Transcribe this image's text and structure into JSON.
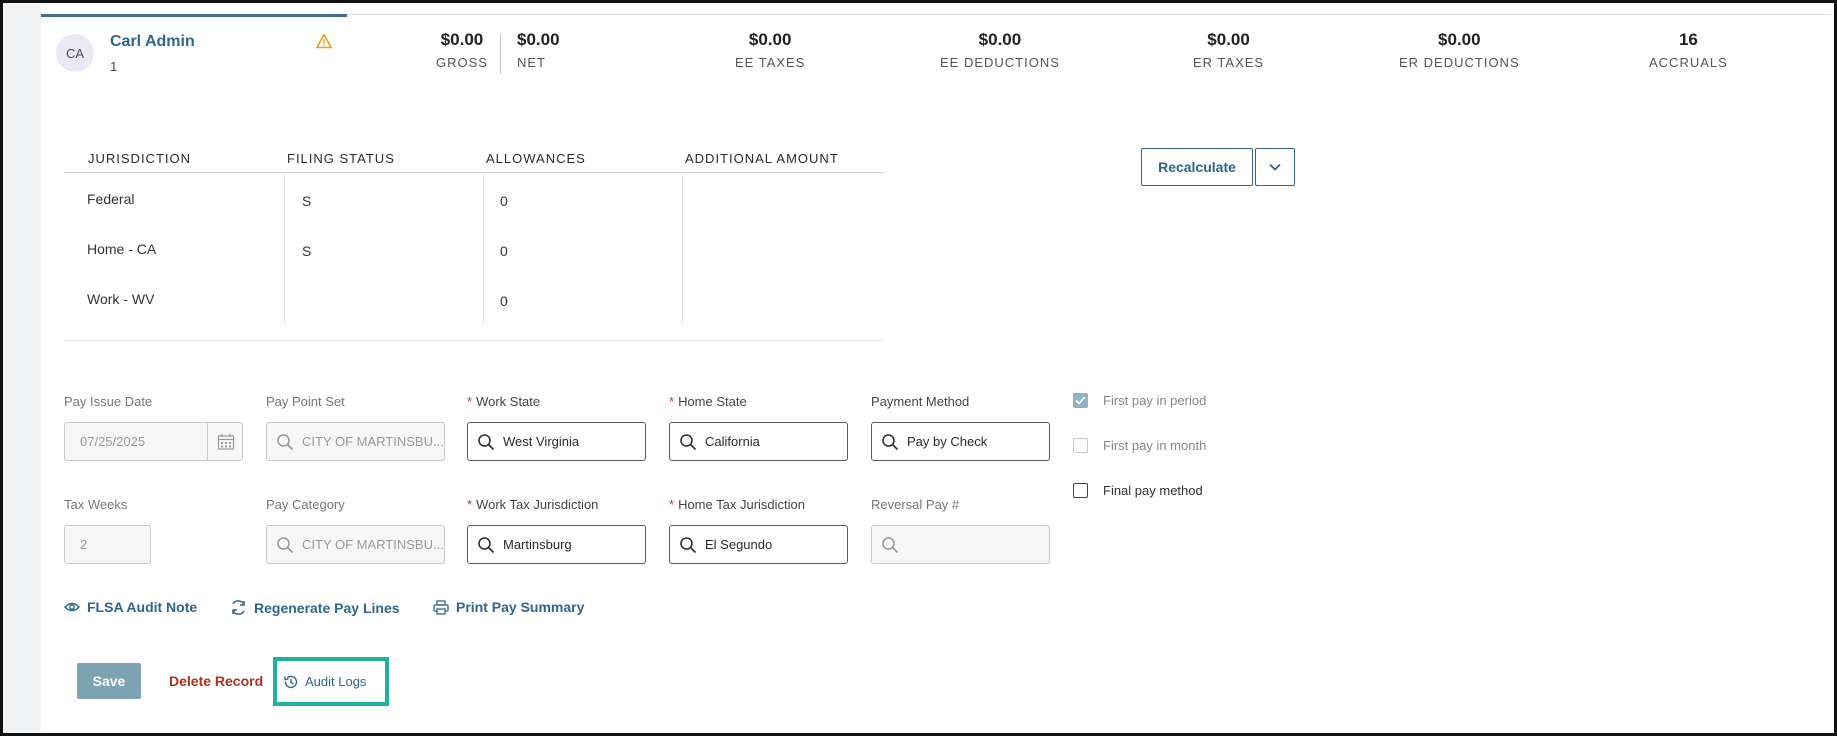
{
  "employee": {
    "initials": "CA",
    "name": "Carl Admin",
    "number": "1"
  },
  "metrics": [
    {
      "value": "$0.00",
      "label": "GROSS"
    },
    {
      "value": "$0.00",
      "label": "NET"
    },
    {
      "value": "$0.00",
      "label": "EE TAXES"
    },
    {
      "value": "$0.00",
      "label": "EE DEDUCTIONS"
    },
    {
      "value": "$0.00",
      "label": "ER TAXES"
    },
    {
      "value": "$0.00",
      "label": "ER DEDUCTIONS"
    },
    {
      "value": "16",
      "label": "ACCRUALS"
    }
  ],
  "tax_table": {
    "headers": [
      "JURISDICTION",
      "FILING STATUS",
      "ALLOWANCES",
      "ADDITIONAL AMOUNT"
    ],
    "rows": [
      {
        "jurisdiction": "Federal",
        "filing_status": "S",
        "allowances": "0",
        "additional": ""
      },
      {
        "jurisdiction": "Home - CA",
        "filing_status": "S",
        "allowances": "0",
        "additional": ""
      },
      {
        "jurisdiction": "Work - WV",
        "filing_status": "",
        "allowances": "0",
        "additional": ""
      }
    ]
  },
  "actions": {
    "recalculate": "Recalculate"
  },
  "form": {
    "pay_issue_date": {
      "label": "Pay Issue Date",
      "value": "07/25/2025"
    },
    "pay_point_set": {
      "label": "Pay Point Set",
      "value": "CITY OF MARTINSBU..."
    },
    "work_state": {
      "label": "Work State",
      "value": "West Virginia"
    },
    "home_state": {
      "label": "Home State",
      "value": "California"
    },
    "payment_method": {
      "label": "Payment Method",
      "value": "Pay by Check"
    },
    "tax_weeks": {
      "label": "Tax Weeks",
      "value": "2"
    },
    "pay_category": {
      "label": "Pay Category",
      "value": "CITY OF MARTINSBU..."
    },
    "work_tax_jurisdiction": {
      "label": "Work Tax Jurisdiction",
      "value": "Martinsburg"
    },
    "home_tax_jurisdiction": {
      "label": "Home Tax Jurisdiction",
      "value": "El Segundo"
    },
    "reversal_pay": {
      "label": "Reversal Pay #",
      "value": ""
    },
    "required_mark": "*"
  },
  "checks": [
    {
      "label": "First pay in period",
      "checked": true
    },
    {
      "label": "First pay in month",
      "checked": false
    },
    {
      "label": "Final pay method",
      "checked": false
    }
  ],
  "links": {
    "flsa": "FLSA Audit Note",
    "regenerate": "Regenerate Pay Lines",
    "print": "Print Pay Summary"
  },
  "footer": {
    "save": "Save",
    "delete": "Delete Record",
    "audit": "Audit Logs"
  },
  "colors": {
    "accent": "#2f6690",
    "highlight": "#1eb0a0",
    "danger": "#b0301e",
    "warning": "#e8a317"
  }
}
